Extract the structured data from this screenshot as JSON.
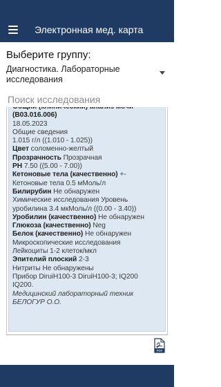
{
  "app": {
    "title": "Электронная мед. карта"
  },
  "group": {
    "label": "Выберите группу:",
    "selected": "Диагностика. Лабораторные исследования"
  },
  "search": {
    "placeholder": "Поиск исследования",
    "value": ""
  },
  "result": {
    "lines": [
      {
        "text": "Общий (клинический) анализ мочи",
        "style": "b"
      },
      {
        "text": "(B03.016.006)",
        "style": "b"
      },
      {
        "text": "18.05.2023",
        "style": ""
      },
      {
        "text": "Общие сведения",
        "style": ""
      },
      {
        "text": "1.015 г/л ((1.010 - 1.025))",
        "style": ""
      },
      {
        "label": "Цвет",
        "text": "соломенно-желтый"
      },
      {
        "label": "Прозрачность",
        "text": "Прозрачная"
      },
      {
        "label": "PH",
        "text": "7.50 ((5.00 - 7.00))"
      },
      {
        "label": "Кетоновые тела (качественно)",
        "text": "+-"
      },
      {
        "text": "Кетоновые тела 0.5 мМоль/л",
        "style": ""
      },
      {
        "label": "Билирубин",
        "text": "Не обнаружен"
      },
      {
        "text": "Химические исследования Уровень",
        "style": ""
      },
      {
        "text": "уробилина 3.4 мкМоль/л ((0.00 - 3.40))",
        "style": ""
      },
      {
        "label": "Уробилин (качественно)",
        "text": "Не обнаружен"
      },
      {
        "label": "Глюкоза (качественно)",
        "text": "Neg"
      },
      {
        "label": "Белок (качественно)",
        "text": "Не обнаружен"
      },
      {
        "text": "Микроскопические исследования",
        "style": ""
      },
      {
        "text": "Лейкоциты 1-2 клеток/мкл",
        "style": ""
      },
      {
        "label": "Эпителий плоский",
        "text": "2-3"
      },
      {
        "text": "Нитриты Не обнаружены",
        "style": ""
      },
      {
        "text": "Прибор DiruiH100-3 DiruiH100-3; IQ200",
        "style": ""
      },
      {
        "text": "IQ200.",
        "style": ""
      },
      {
        "text": "Медицинский лабораторный техник",
        "style": "i"
      },
      {
        "text": "БЕЛОГУР О.О.",
        "style": "i"
      }
    ]
  },
  "pdf_icon": {
    "name": "pdf-icon",
    "label": "PDF"
  },
  "colors": {
    "primary": "#1f3a63",
    "card_background": "#dde8f3",
    "pdf_red": "#1f3a63"
  }
}
